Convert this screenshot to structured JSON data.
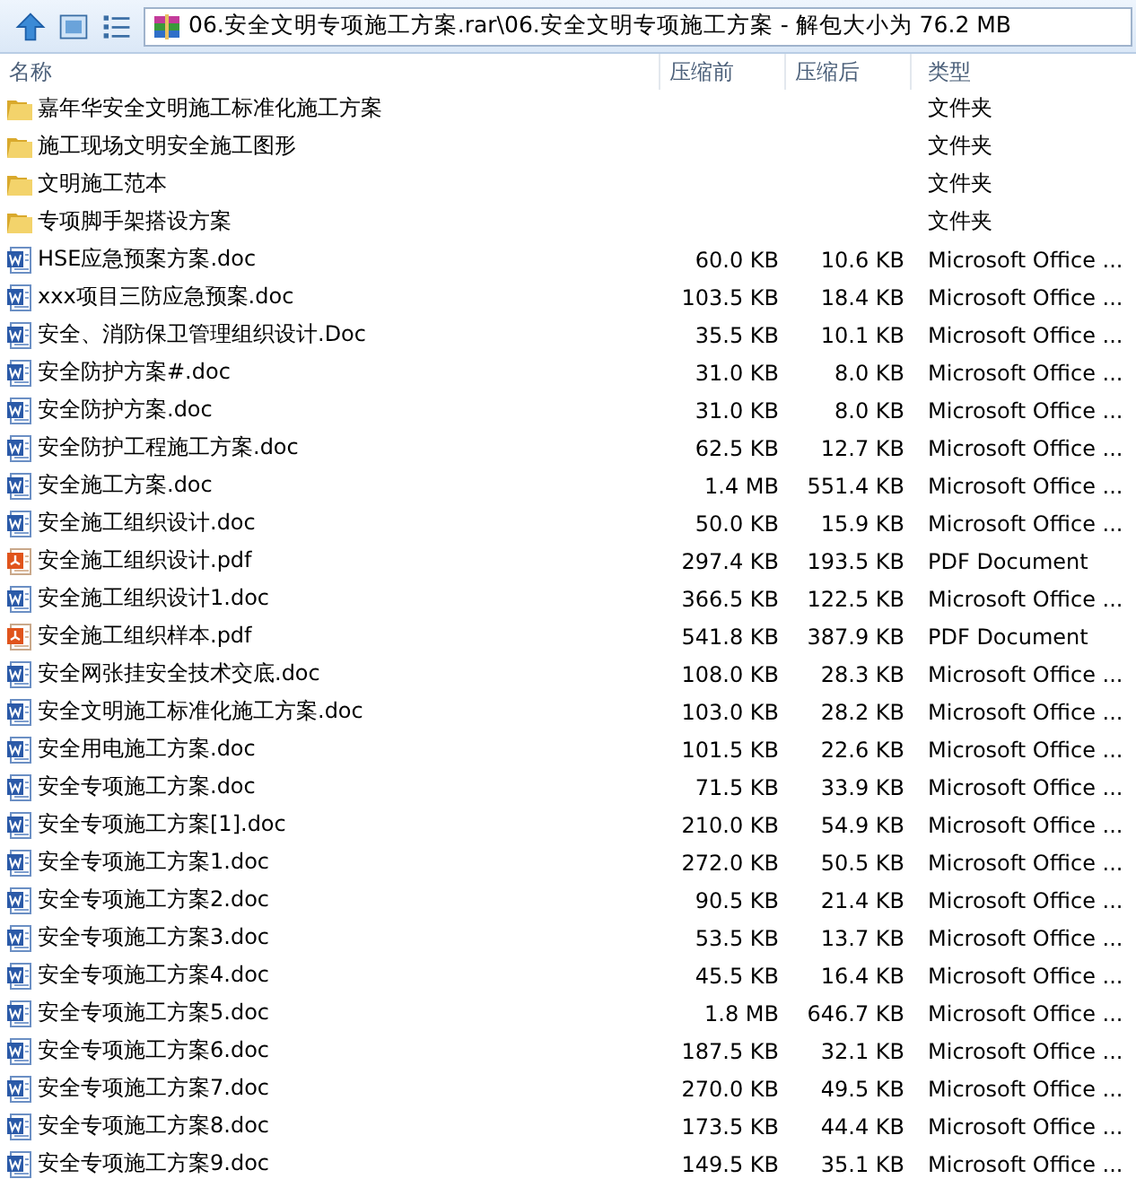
{
  "toolbar": {
    "path": "06.安全文明专项施工方案.rar\\06.安全文明专项施工方案 - 解包大小为 76.2 MB"
  },
  "table": {
    "columns": [
      "名称",
      "压缩前",
      "压缩后",
      "类型"
    ],
    "rows": [
      {
        "kind": "folder",
        "name": "嘉年华安全文明施工标准化施工方案",
        "size": "",
        "packed": "",
        "type": "文件夹"
      },
      {
        "kind": "folder",
        "name": "施工现场文明安全施工图形",
        "size": "",
        "packed": "",
        "type": "文件夹"
      },
      {
        "kind": "folder",
        "name": "文明施工范本",
        "size": "",
        "packed": "",
        "type": "文件夹"
      },
      {
        "kind": "folder",
        "name": "专项脚手架搭设方案",
        "size": "",
        "packed": "",
        "type": "文件夹"
      },
      {
        "kind": "doc",
        "name": "HSE应急预案方案.doc",
        "size": "60.0 KB",
        "packed": "10.6 KB",
        "type": "Microsoft Office ..."
      },
      {
        "kind": "doc",
        "name": "xxx项目三防应急预案.doc",
        "size": "103.5 KB",
        "packed": "18.4 KB",
        "type": "Microsoft Office ..."
      },
      {
        "kind": "doc",
        "name": "安全、消防保卫管理组织设计.Doc",
        "size": "35.5 KB",
        "packed": "10.1 KB",
        "type": "Microsoft Office ..."
      },
      {
        "kind": "doc",
        "name": "安全防护方案#.doc",
        "size": "31.0 KB",
        "packed": "8.0 KB",
        "type": "Microsoft Office ..."
      },
      {
        "kind": "doc",
        "name": "安全防护方案.doc",
        "size": "31.0 KB",
        "packed": "8.0 KB",
        "type": "Microsoft Office ..."
      },
      {
        "kind": "doc",
        "name": "安全防护工程施工方案.doc",
        "size": "62.5 KB",
        "packed": "12.7 KB",
        "type": "Microsoft Office ..."
      },
      {
        "kind": "doc",
        "name": "安全施工方案.doc",
        "size": "1.4 MB",
        "packed": "551.4 KB",
        "type": "Microsoft Office ..."
      },
      {
        "kind": "doc",
        "name": "安全施工组织设计.doc",
        "size": "50.0 KB",
        "packed": "15.9 KB",
        "type": "Microsoft Office ..."
      },
      {
        "kind": "pdf",
        "name": "安全施工组织设计.pdf",
        "size": "297.4 KB",
        "packed": "193.5 KB",
        "type": "PDF Document"
      },
      {
        "kind": "doc",
        "name": "安全施工组织设计1.doc",
        "size": "366.5 KB",
        "packed": "122.5 KB",
        "type": "Microsoft Office ..."
      },
      {
        "kind": "pdf",
        "name": "安全施工组织样本.pdf",
        "size": "541.8 KB",
        "packed": "387.9 KB",
        "type": "PDF Document"
      },
      {
        "kind": "doc",
        "name": "安全网张挂安全技术交底.doc",
        "size": "108.0 KB",
        "packed": "28.3 KB",
        "type": "Microsoft Office ..."
      },
      {
        "kind": "doc",
        "name": "安全文明施工标准化施工方案.doc",
        "size": "103.0 KB",
        "packed": "28.2 KB",
        "type": "Microsoft Office ..."
      },
      {
        "kind": "doc",
        "name": "安全用电施工方案.doc",
        "size": "101.5 KB",
        "packed": "22.6 KB",
        "type": "Microsoft Office ..."
      },
      {
        "kind": "doc",
        "name": "安全专项施工方案.doc",
        "size": "71.5 KB",
        "packed": "33.9 KB",
        "type": "Microsoft Office ..."
      },
      {
        "kind": "doc",
        "name": "安全专项施工方案[1].doc",
        "size": "210.0 KB",
        "packed": "54.9 KB",
        "type": "Microsoft Office ..."
      },
      {
        "kind": "doc",
        "name": "安全专项施工方案1.doc",
        "size": "272.0 KB",
        "packed": "50.5 KB",
        "type": "Microsoft Office ..."
      },
      {
        "kind": "doc",
        "name": "安全专项施工方案2.doc",
        "size": "90.5 KB",
        "packed": "21.4 KB",
        "type": "Microsoft Office ..."
      },
      {
        "kind": "doc",
        "name": "安全专项施工方案3.doc",
        "size": "53.5 KB",
        "packed": "13.7 KB",
        "type": "Microsoft Office ..."
      },
      {
        "kind": "doc",
        "name": "安全专项施工方案4.doc",
        "size": "45.5 KB",
        "packed": "16.4 KB",
        "type": "Microsoft Office ..."
      },
      {
        "kind": "doc",
        "name": "安全专项施工方案5.doc",
        "size": "1.8 MB",
        "packed": "646.7 KB",
        "type": "Microsoft Office ..."
      },
      {
        "kind": "doc",
        "name": "安全专项施工方案6.doc",
        "size": "187.5 KB",
        "packed": "32.1 KB",
        "type": "Microsoft Office ..."
      },
      {
        "kind": "doc",
        "name": "安全专项施工方案7.doc",
        "size": "270.0 KB",
        "packed": "49.5 KB",
        "type": "Microsoft Office ..."
      },
      {
        "kind": "doc",
        "name": "安全专项施工方案8.doc",
        "size": "173.5 KB",
        "packed": "44.4 KB",
        "type": "Microsoft Office ..."
      },
      {
        "kind": "doc",
        "name": "安全专项施工方案9.doc",
        "size": "149.5 KB",
        "packed": "35.1 KB",
        "type": "Microsoft Office ..."
      }
    ]
  }
}
